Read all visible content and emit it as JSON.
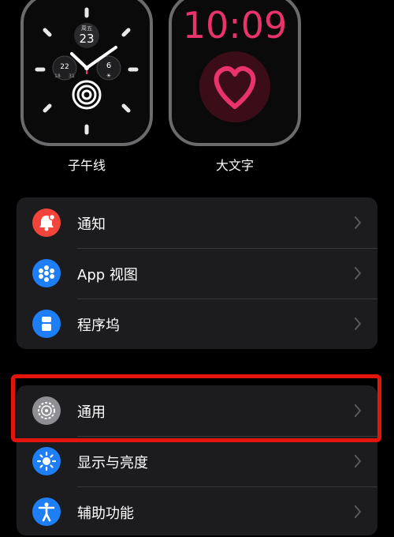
{
  "faces": [
    {
      "label": "子午线",
      "day": "周五",
      "date": "23",
      "sub_left_top": "22",
      "sub_left_mid": "18",
      "sub_left_bot": "31",
      "sub_right_top": "6"
    },
    {
      "label": "大文字",
      "time": "10:09"
    }
  ],
  "group1": [
    {
      "label": "通知",
      "icon": "bell-icon",
      "color": "#f2443a"
    },
    {
      "label": "App 视图",
      "icon": "app-grid-icon",
      "color": "#1d7ef5"
    },
    {
      "label": "程序坞",
      "icon": "dock-icon",
      "color": "#1d7ef5"
    }
  ],
  "group2": [
    {
      "label": "通用",
      "icon": "gear-icon",
      "color": "#8e8e93"
    },
    {
      "label": "显示与亮度",
      "icon": "sun-icon",
      "color": "#1d7ef5"
    },
    {
      "label": "辅助功能",
      "icon": "accessibility-icon",
      "color": "#1d7ef5"
    }
  ],
  "colors": {
    "highlight": "#e3140c",
    "card": "#1c1c1e",
    "pink": "#e8336b"
  }
}
